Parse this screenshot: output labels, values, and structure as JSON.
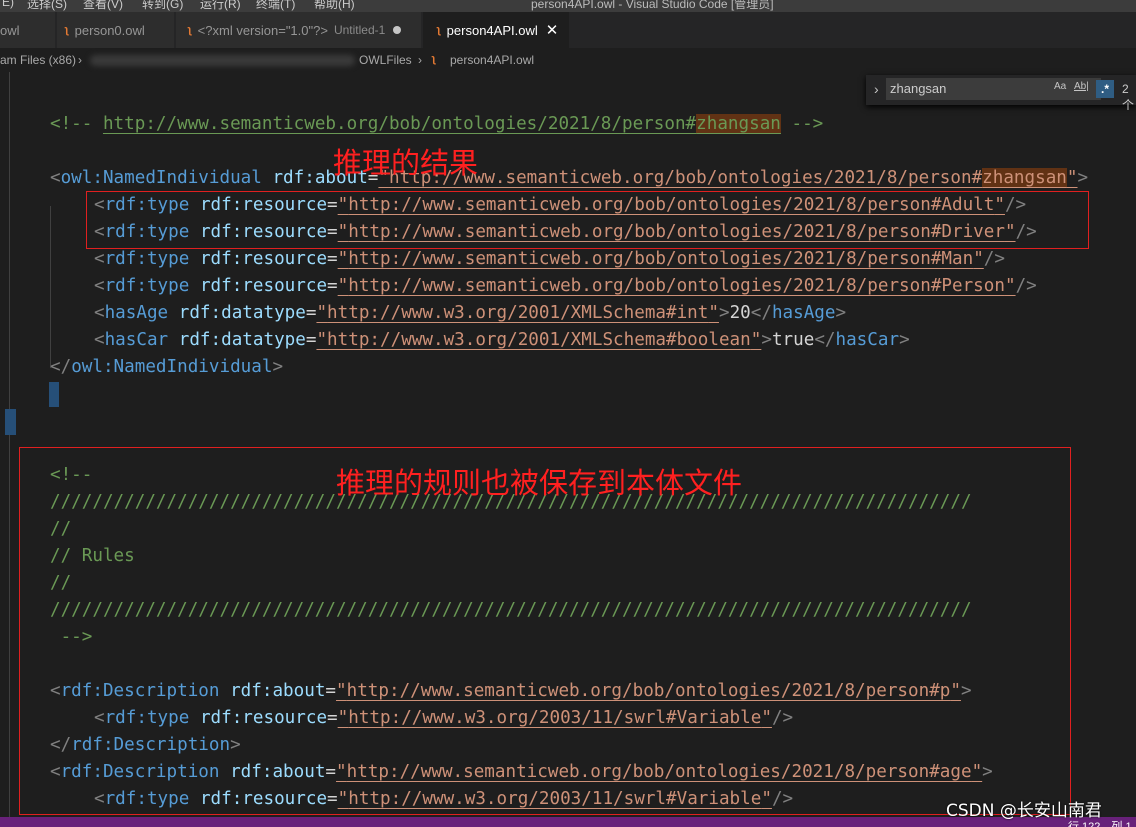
{
  "menubar": {
    "items": [
      "E)",
      "选择(S)",
      "查看(V)",
      "转到(G)",
      "运行(R)",
      "终端(T)",
      "帮助(H)"
    ],
    "window_title": "person4API.owl - Visual Studio Code [管理员]"
  },
  "tabs": [
    {
      "label": "owl",
      "description": "",
      "state": "normal"
    },
    {
      "label": "person0.owl",
      "description": "",
      "state": "normal"
    },
    {
      "label": "<?xml version=\"1.0\"?>",
      "description": "Untitled-1",
      "state": "unsaved"
    },
    {
      "label": "person4API.owl",
      "description": "",
      "state": "active"
    }
  ],
  "breadcrumb": {
    "segments": [
      "am Files (x86)",
      "OWLFiles",
      "person4API.owl"
    ]
  },
  "find_widget": {
    "query": "zhangsan",
    "match_case": "Aa",
    "whole_word": "Ab|",
    "regex": ".*",
    "count": "2 个"
  },
  "code": {
    "l1": {
      "open": "<!-- ",
      "url_pre": "http://www.semanticweb.org/bob/ontologies/2021/8/person#",
      "match": "zhangsan",
      "close": " -->"
    },
    "l2": {
      "lt": "<",
      "tag": "owl:NamedIndividual",
      "attr": "rdf:about",
      "eq": "=",
      "q": "\"",
      "url_pre": "http://www.semanticweb.org/bob/ontologies/2021/8/person#",
      "match": "zhangsan",
      "q2": "\"",
      "gt": ">"
    },
    "types": [
      {
        "tag": "rdf:type",
        "attr": "rdf:resource",
        "url": "http://www.semanticweb.org/bob/ontologies/2021/8/person#Adult"
      },
      {
        "tag": "rdf:type",
        "attr": "rdf:resource",
        "url": "http://www.semanticweb.org/bob/ontologies/2021/8/person#Driver"
      },
      {
        "tag": "rdf:type",
        "attr": "rdf:resource",
        "url": "http://www.semanticweb.org/bob/ontologies/2021/8/person#Man"
      },
      {
        "tag": "rdf:type",
        "attr": "rdf:resource",
        "url": "http://www.semanticweb.org/bob/ontologies/2021/8/person#Person"
      }
    ],
    "age": {
      "tag": "hasAge",
      "attr": "rdf:datatype",
      "url": "http://www.w3.org/2001/XMLSchema#int",
      "value": "20"
    },
    "car": {
      "tag": "hasCar",
      "attr": "rdf:datatype",
      "url": "http://www.w3.org/2001/XMLSchema#boolean",
      "value": "true"
    },
    "close_tag": "owl:NamedIndividual",
    "rules_comment": {
      "open": "<!--",
      "slashes": "///////////////////////////////////////////////////////////////////////////////////////",
      "blank": "//",
      "rules": "// Rules",
      "close": " -->"
    },
    "desc1": {
      "tag": "rdf:Description",
      "attr": "rdf:about",
      "url": "http://www.semanticweb.org/bob/ontologies/2021/8/person#p"
    },
    "var1": {
      "tag": "rdf:type",
      "attr": "rdf:resource",
      "url": "http://www.w3.org/2003/11/swrl#Variable"
    },
    "desc_close": "rdf:Description",
    "desc2": {
      "tag": "rdf:Description",
      "attr": "rdf:about",
      "url": "http://www.semanticweb.org/bob/ontologies/2021/8/person#age"
    },
    "var2": {
      "tag": "rdf:type",
      "attr": "rdf:resource",
      "url": "http://www.w3.org/2003/11/swrl#Variable"
    }
  },
  "annotations": {
    "result": "推理的结果",
    "rules_saved": "推理的规则也被保存到本体文件"
  },
  "statusbar": {
    "position": "行 122，列 1"
  },
  "watermark": "CSDN @长安山南君",
  "colors": {
    "tag": "#569cd6",
    "attr": "#9cdcfe",
    "string": "#ce9178",
    "comment": "#6a9955",
    "annotation": "#ff2020",
    "status": "#68217a"
  }
}
